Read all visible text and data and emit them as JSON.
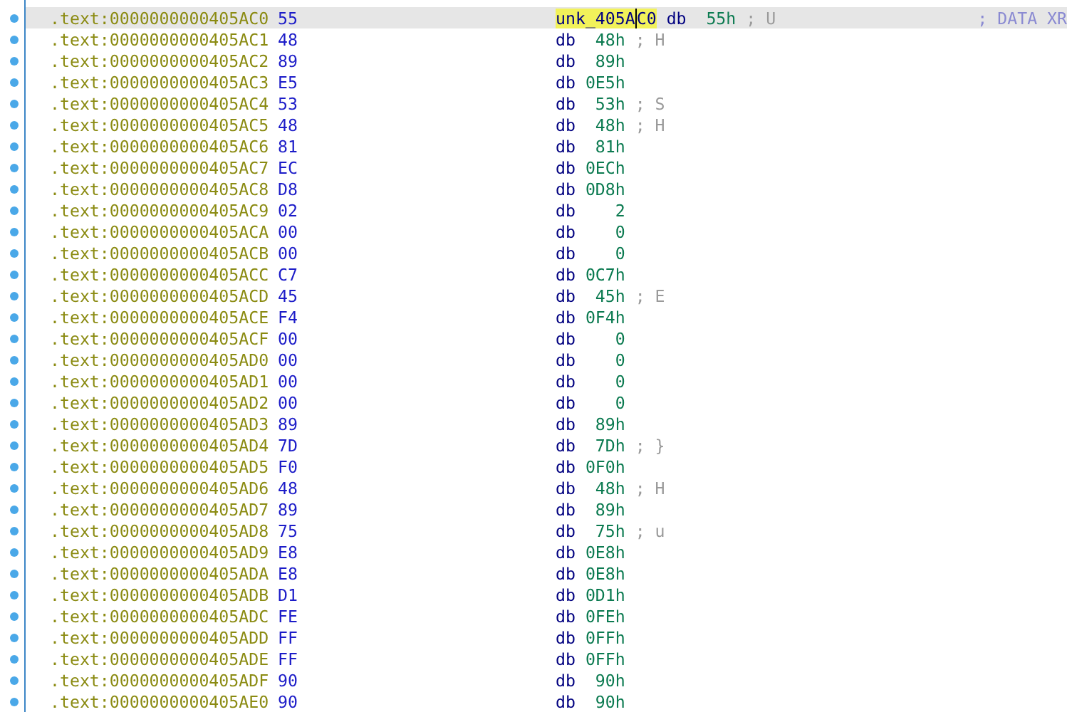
{
  "rows": [
    {
      "address": ".text:0000000000405AC0",
      "byte": "55",
      "label_around_cursor": [
        "unk_405A",
        "C0"
      ],
      "directive": "db",
      "value": "55h",
      "comment": "; U",
      "xref": "; DATA XR",
      "selected": true
    },
    {
      "address": ".text:0000000000405AC1",
      "byte": "48",
      "directive": "db",
      "value": "48h",
      "comment": "; H",
      "selected": false
    },
    {
      "address": ".text:0000000000405AC2",
      "byte": "89",
      "directive": "db",
      "value": "89h",
      "selected": false
    },
    {
      "address": ".text:0000000000405AC3",
      "byte": "E5",
      "directive": "db",
      "value": "0E5h",
      "selected": false
    },
    {
      "address": ".text:0000000000405AC4",
      "byte": "53",
      "directive": "db",
      "value": "53h",
      "comment": "; S",
      "selected": false
    },
    {
      "address": ".text:0000000000405AC5",
      "byte": "48",
      "directive": "db",
      "value": "48h",
      "comment": "; H",
      "selected": false
    },
    {
      "address": ".text:0000000000405AC6",
      "byte": "81",
      "directive": "db",
      "value": "81h",
      "selected": false
    },
    {
      "address": ".text:0000000000405AC7",
      "byte": "EC",
      "directive": "db",
      "value": "0ECh",
      "selected": false
    },
    {
      "address": ".text:0000000000405AC8",
      "byte": "D8",
      "directive": "db",
      "value": "0D8h",
      "selected": false
    },
    {
      "address": ".text:0000000000405AC9",
      "byte": "02",
      "directive": "db",
      "value": "2",
      "selected": false
    },
    {
      "address": ".text:0000000000405ACA",
      "byte": "00",
      "directive": "db",
      "value": "0",
      "selected": false
    },
    {
      "address": ".text:0000000000405ACB",
      "byte": "00",
      "directive": "db",
      "value": "0",
      "selected": false
    },
    {
      "address": ".text:0000000000405ACC",
      "byte": "C7",
      "directive": "db",
      "value": "0C7h",
      "selected": false
    },
    {
      "address": ".text:0000000000405ACD",
      "byte": "45",
      "directive": "db",
      "value": "45h",
      "comment": "; E",
      "selected": false
    },
    {
      "address": ".text:0000000000405ACE",
      "byte": "F4",
      "directive": "db",
      "value": "0F4h",
      "selected": false
    },
    {
      "address": ".text:0000000000405ACF",
      "byte": "00",
      "directive": "db",
      "value": "0",
      "selected": false
    },
    {
      "address": ".text:0000000000405AD0",
      "byte": "00",
      "directive": "db",
      "value": "0",
      "selected": false
    },
    {
      "address": ".text:0000000000405AD1",
      "byte": "00",
      "directive": "db",
      "value": "0",
      "selected": false
    },
    {
      "address": ".text:0000000000405AD2",
      "byte": "00",
      "directive": "db",
      "value": "0",
      "selected": false
    },
    {
      "address": ".text:0000000000405AD3",
      "byte": "89",
      "directive": "db",
      "value": "89h",
      "selected": false
    },
    {
      "address": ".text:0000000000405AD4",
      "byte": "7D",
      "directive": "db",
      "value": "7Dh",
      "comment": "; }",
      "selected": false
    },
    {
      "address": ".text:0000000000405AD5",
      "byte": "F0",
      "directive": "db",
      "value": "0F0h",
      "selected": false
    },
    {
      "address": ".text:0000000000405AD6",
      "byte": "48",
      "directive": "db",
      "value": "48h",
      "comment": "; H",
      "selected": false
    },
    {
      "address": ".text:0000000000405AD7",
      "byte": "89",
      "directive": "db",
      "value": "89h",
      "selected": false
    },
    {
      "address": ".text:0000000000405AD8",
      "byte": "75",
      "directive": "db",
      "value": "75h",
      "comment": "; u",
      "selected": false
    },
    {
      "address": ".text:0000000000405AD9",
      "byte": "E8",
      "directive": "db",
      "value": "0E8h",
      "selected": false
    },
    {
      "address": ".text:0000000000405ADA",
      "byte": "E8",
      "directive": "db",
      "value": "0E8h",
      "selected": false
    },
    {
      "address": ".text:0000000000405ADB",
      "byte": "D1",
      "directive": "db",
      "value": "0D1h",
      "selected": false
    },
    {
      "address": ".text:0000000000405ADC",
      "byte": "FE",
      "directive": "db",
      "value": "0FEh",
      "selected": false
    },
    {
      "address": ".text:0000000000405ADD",
      "byte": "FF",
      "directive": "db",
      "value": "0FFh",
      "selected": false
    },
    {
      "address": ".text:0000000000405ADE",
      "byte": "FF",
      "directive": "db",
      "value": "0FFh",
      "selected": false
    },
    {
      "address": ".text:0000000000405ADF",
      "byte": "90",
      "directive": "db",
      "value": "90h",
      "selected": false
    },
    {
      "address": ".text:0000000000405AE0",
      "byte": "90",
      "directive": "db",
      "value": "90h",
      "selected": false
    }
  ]
}
